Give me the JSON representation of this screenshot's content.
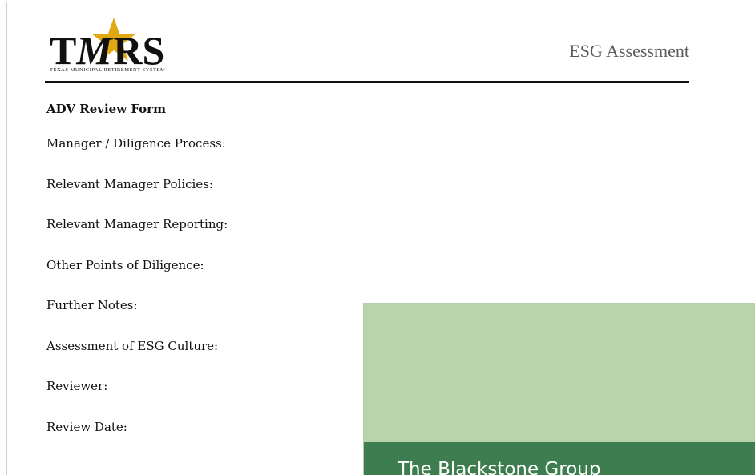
{
  "logo": {
    "letters_left": "T",
    "letters_middle": "M",
    "letters_right": "RS",
    "tagline": "Texas Municipal Retirement System",
    "star_color": "#e0a812"
  },
  "header": {
    "title": "ESG Assessment"
  },
  "form": {
    "title": "ADV Review Form",
    "fields": [
      "Manager / Diligence Process:",
      "Relevant Manager Policies:",
      "Relevant Manager Reporting:",
      "Other Points of Diligence:",
      "Further Notes:",
      "Assessment of ESG Culture:",
      "Reviewer:",
      "Review Date:"
    ]
  },
  "cover": {
    "title": "The Blackstone Group",
    "top_color": "#b8d4ac",
    "bottom_color": "#3e7d4f"
  }
}
